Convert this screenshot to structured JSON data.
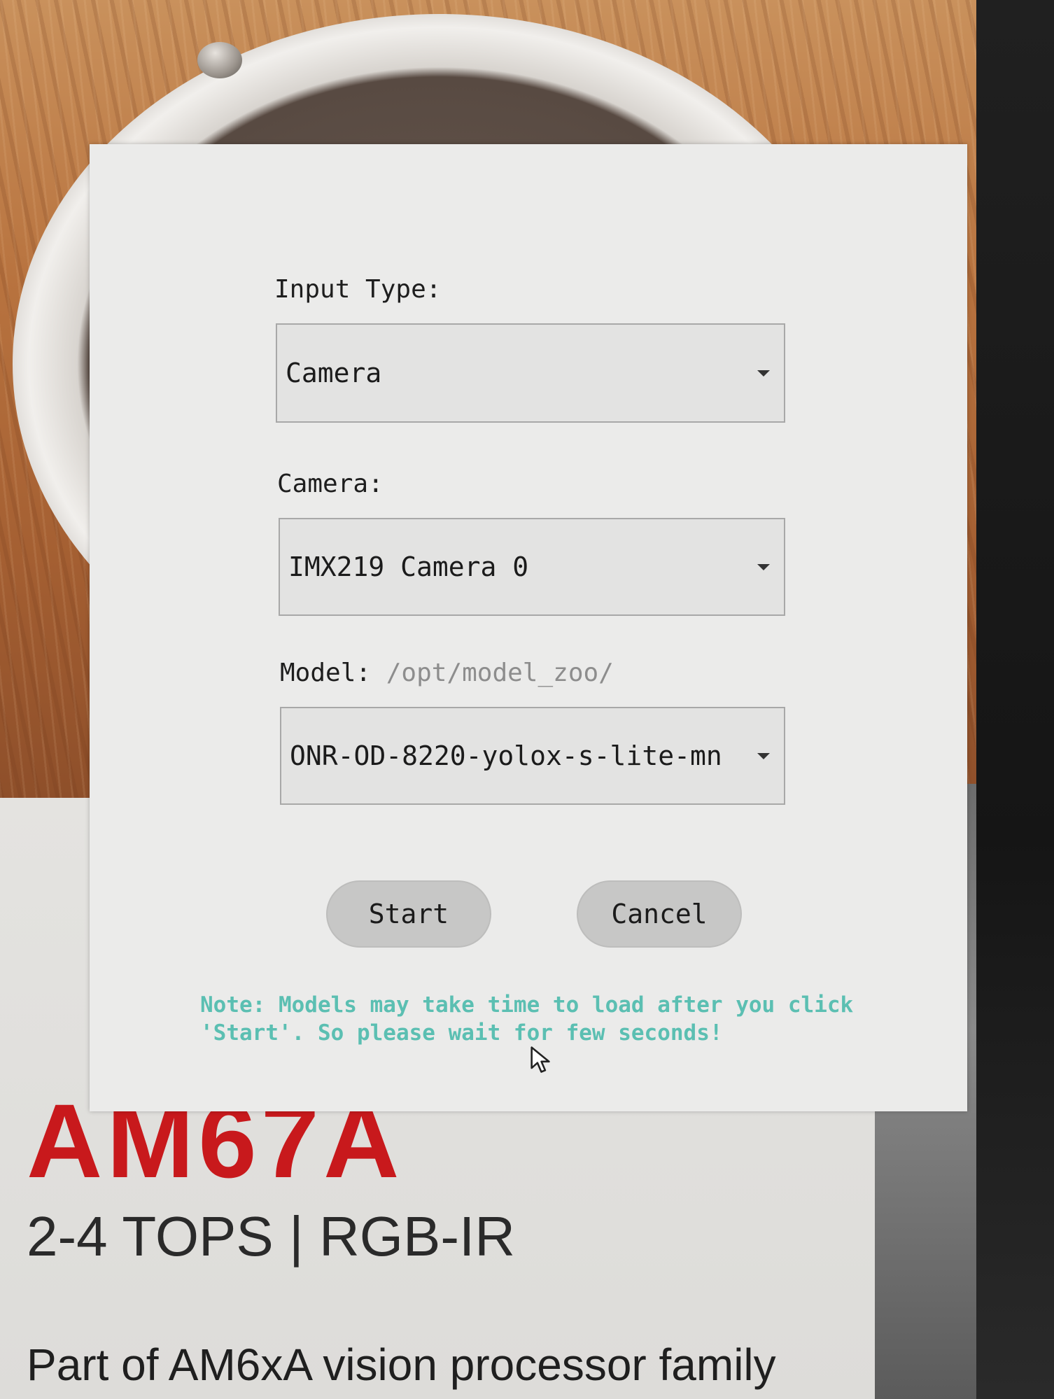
{
  "dialog": {
    "input_type": {
      "label": "Input Type:",
      "value": "Camera"
    },
    "camera": {
      "label": "Camera:",
      "value": "IMX219 Camera 0"
    },
    "model": {
      "label": "Model:",
      "path_hint": "/opt/model_zoo/",
      "value": "ONR-OD-8220-yolox-s-lite-mn"
    },
    "buttons": {
      "start": "Start",
      "cancel": "Cancel"
    },
    "note": "Note: Models may take time to load after you click 'Start'. So please wait for few seconds!"
  },
  "background": {
    "brand_title": "AM67A",
    "brand_subtitle": "2-4 TOPS | RGB-IR",
    "brand_tagline": "Part of AM6xA vision processor family"
  },
  "colors": {
    "note_text": "#5bbfb2",
    "brand_red": "#c8191c",
    "dialog_bg": "#ebebea"
  },
  "icons": {
    "dropdown": "chevron-down-icon",
    "pointer": "mouse-cursor-icon"
  }
}
